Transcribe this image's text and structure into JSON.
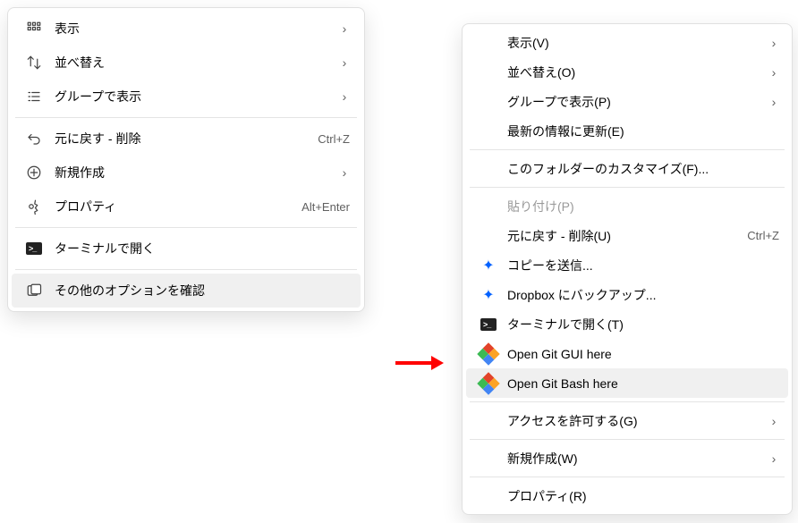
{
  "menuLeft": {
    "items": [
      {
        "label": "表示",
        "icon": "view",
        "hasSub": true
      },
      {
        "label": "並べ替え",
        "icon": "sort",
        "hasSub": true
      },
      {
        "label": "グループで表示",
        "icon": "group",
        "hasSub": true
      },
      {
        "sep": true
      },
      {
        "label": "元に戻す - 削除",
        "icon": "undo",
        "shortcut": "Ctrl+Z"
      },
      {
        "label": "新規作成",
        "icon": "new",
        "hasSub": true
      },
      {
        "label": "プロパティ",
        "icon": "props",
        "shortcut": "Alt+Enter"
      },
      {
        "sep": true
      },
      {
        "label": "ターミナルで開く",
        "icon": "terminal"
      },
      {
        "sep": true
      },
      {
        "label": "その他のオプションを確認",
        "icon": "more",
        "hovered": true
      }
    ]
  },
  "menuRight": {
    "items": [
      {
        "label": "表示(V)",
        "hasSub": true,
        "indent": true
      },
      {
        "label": "並べ替え(O)",
        "hasSub": true,
        "indent": true
      },
      {
        "label": "グループで表示(P)",
        "hasSub": true,
        "indent": true
      },
      {
        "label": "最新の情報に更新(E)",
        "indent": true
      },
      {
        "sep": true
      },
      {
        "label": "このフォルダーのカスタマイズ(F)...",
        "indent": true
      },
      {
        "sep": true
      },
      {
        "label": "貼り付け(P)",
        "disabled": true,
        "indent": true
      },
      {
        "label": "元に戻す - 削除(U)",
        "shortcut": "Ctrl+Z",
        "indent": true
      },
      {
        "label": "コピーを送信...",
        "icon": "dropbox"
      },
      {
        "label": "Dropbox にバックアップ...",
        "icon": "dropbox"
      },
      {
        "label": "ターミナルで開く(T)",
        "icon": "terminal"
      },
      {
        "label": "Open Git GUI here",
        "icon": "git"
      },
      {
        "label": "Open Git Bash here",
        "icon": "git",
        "hovered": true
      },
      {
        "sep": true
      },
      {
        "label": "アクセスを許可する(G)",
        "hasSub": true,
        "indent": true
      },
      {
        "sep": true
      },
      {
        "label": "新規作成(W)",
        "hasSub": true,
        "indent": true
      },
      {
        "sep": true
      },
      {
        "label": "プロパティ(R)",
        "indent": true
      }
    ]
  }
}
